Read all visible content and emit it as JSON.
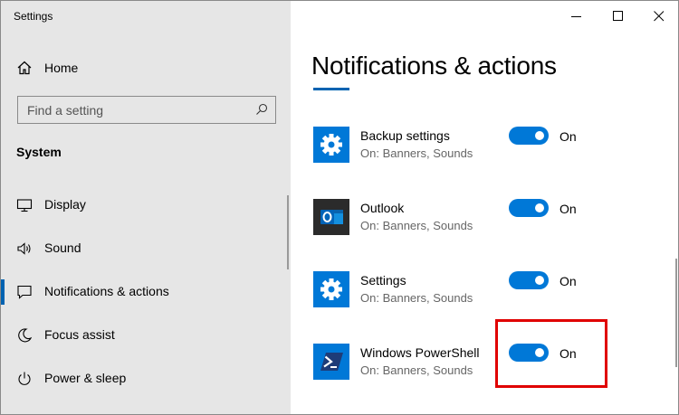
{
  "window": {
    "title": "Settings",
    "controls": [
      "minimize-icon",
      "maximize-icon",
      "close-icon"
    ]
  },
  "sidebar": {
    "home_label": "Home",
    "search_placeholder": "Find a setting",
    "section_title": "System",
    "items": [
      {
        "label": "Display",
        "icon": "display-icon"
      },
      {
        "label": "Sound",
        "icon": "sound-icon"
      },
      {
        "label": "Notifications & actions",
        "icon": "notifications-icon",
        "active": true
      },
      {
        "label": "Focus assist",
        "icon": "focus-assist-icon"
      },
      {
        "label": "Power & sleep",
        "icon": "power-icon"
      }
    ]
  },
  "main": {
    "title": "Notifications & actions",
    "apps": [
      {
        "name": "Backup settings",
        "subtitle": "On: Banners, Sounds",
        "toggle_label": "On",
        "icon": "gear-icon"
      },
      {
        "name": "Outlook",
        "subtitle": "On: Banners, Sounds",
        "toggle_label": "On",
        "icon": "outlook-icon"
      },
      {
        "name": "Settings",
        "subtitle": "On: Banners, Sounds",
        "toggle_label": "On",
        "icon": "gear-icon"
      },
      {
        "name": "Windows PowerShell",
        "subtitle": "On: Banners, Sounds",
        "toggle_label": "On",
        "icon": "powershell-icon"
      }
    ]
  },
  "colors": {
    "accent": "#0078d7",
    "sidebar_bg": "#e6e6e6",
    "highlight": "#e00000"
  }
}
